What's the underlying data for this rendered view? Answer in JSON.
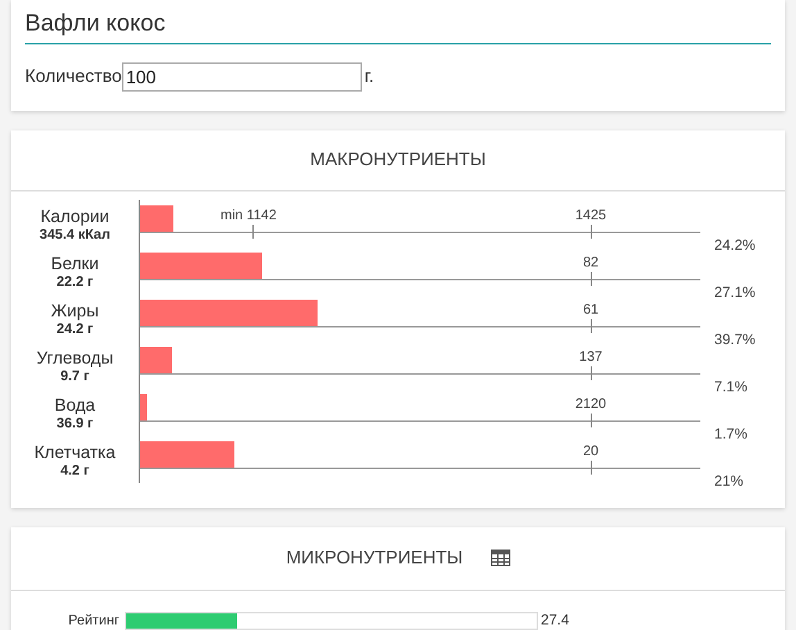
{
  "product": {
    "title": "Вафли кокос",
    "quantity_label": "Количество",
    "quantity_value": "100",
    "unit": "г."
  },
  "macros": {
    "title": "МАКРОНУТРИЕНТЫ",
    "rows": [
      {
        "name": "Калории",
        "amount": "345.4 кКал",
        "level": 0.06,
        "min_label": "min 1142",
        "norm": "1425",
        "percent": "24.2%"
      },
      {
        "name": "Белки",
        "amount": "22.2 г",
        "level": 0.217,
        "norm": "82",
        "percent": "27.1%"
      },
      {
        "name": "Жиры",
        "amount": "24.2 г",
        "level": 0.316,
        "norm": "61",
        "percent": "39.7%"
      },
      {
        "name": "Углеводы",
        "amount": "9.7 г",
        "level": 0.057,
        "norm": "137",
        "percent": "7.1%"
      },
      {
        "name": "Вода",
        "amount": "36.9 г",
        "level": 0.012,
        "norm": "2120",
        "percent": "1.7%"
      },
      {
        "name": "Клетчатка",
        "amount": "4.2 г",
        "level": 0.168,
        "norm": "20",
        "percent": "21%"
      }
    ]
  },
  "micros": {
    "title": "МИКРОНУТРИЕНТЫ",
    "rating": {
      "label": "Рейтинг",
      "level": 0.27,
      "value": "27.4"
    }
  }
}
